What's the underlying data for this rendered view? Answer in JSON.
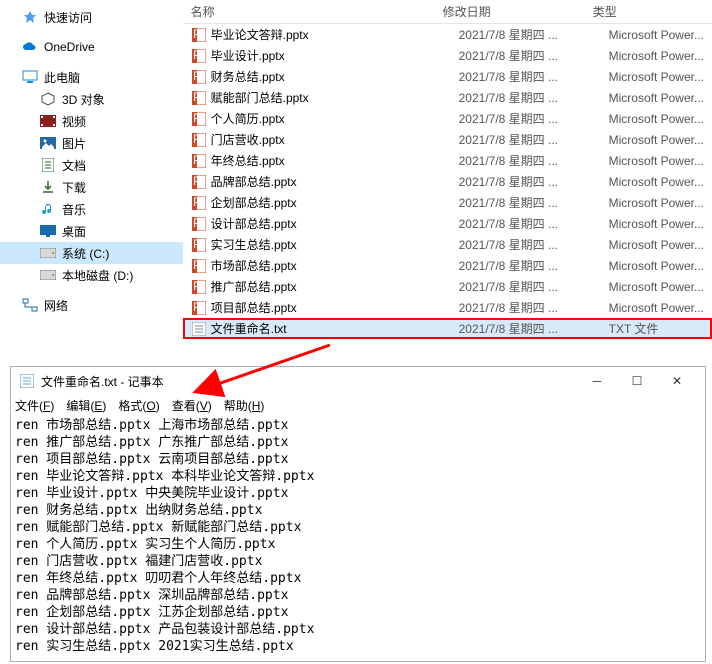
{
  "sidebar": [
    {
      "label": "快速访问",
      "icon": "star",
      "color": "#4aa0e6"
    },
    {
      "label": "OneDrive",
      "icon": "cloud",
      "color": "#0078d4"
    },
    {
      "label": "此电脑",
      "icon": "pc",
      "color": "#1e88e5"
    },
    {
      "label": "3D 对象",
      "icon": "cube",
      "color": "#4a4a4a",
      "indent": true
    },
    {
      "label": "视频",
      "icon": "video",
      "color": "#8a2020",
      "indent": true
    },
    {
      "label": "图片",
      "icon": "image",
      "color": "#206aa8",
      "indent": true
    },
    {
      "label": "文档",
      "icon": "doc",
      "color": "#2a6e2a",
      "indent": true
    },
    {
      "label": "下载",
      "icon": "download",
      "color": "#2a6e2a",
      "indent": true
    },
    {
      "label": "音乐",
      "icon": "music",
      "color": "#1c9cd0",
      "indent": true
    },
    {
      "label": "桌面",
      "icon": "desktop",
      "color": "#1c6aa8",
      "indent": true
    },
    {
      "label": "系统 (C:)",
      "icon": "drive",
      "color": "#808080",
      "indent": true,
      "selected": true
    },
    {
      "label": "本地磁盘 (D:)",
      "icon": "drive",
      "color": "#808080",
      "indent": true
    },
    {
      "label": "网络",
      "icon": "network",
      "color": "#1c6aa8"
    }
  ],
  "columns": {
    "name": "名称",
    "date": "修改日期",
    "type": "类型"
  },
  "files": [
    {
      "name": "毕业论文答辩.pptx",
      "date": "2021/7/8 星期四 ...",
      "type": "Microsoft Power...",
      "icon": "ppt"
    },
    {
      "name": "毕业设计.pptx",
      "date": "2021/7/8 星期四 ...",
      "type": "Microsoft Power...",
      "icon": "ppt"
    },
    {
      "name": "财务总结.pptx",
      "date": "2021/7/8 星期四 ...",
      "type": "Microsoft Power...",
      "icon": "ppt"
    },
    {
      "name": "赋能部门总结.pptx",
      "date": "2021/7/8 星期四 ...",
      "type": "Microsoft Power...",
      "icon": "ppt"
    },
    {
      "name": "个人简历.pptx",
      "date": "2021/7/8 星期四 ...",
      "type": "Microsoft Power...",
      "icon": "ppt"
    },
    {
      "name": "门店营收.pptx",
      "date": "2021/7/8 星期四 ...",
      "type": "Microsoft Power...",
      "icon": "ppt"
    },
    {
      "name": "年终总结.pptx",
      "date": "2021/7/8 星期四 ...",
      "type": "Microsoft Power...",
      "icon": "ppt"
    },
    {
      "name": "品牌部总结.pptx",
      "date": "2021/7/8 星期四 ...",
      "type": "Microsoft Power...",
      "icon": "ppt"
    },
    {
      "name": "企划部总结.pptx",
      "date": "2021/7/8 星期四 ...",
      "type": "Microsoft Power...",
      "icon": "ppt"
    },
    {
      "name": "设计部总结.pptx",
      "date": "2021/7/8 星期四 ...",
      "type": "Microsoft Power...",
      "icon": "ppt"
    },
    {
      "name": "实习生总结.pptx",
      "date": "2021/7/8 星期四 ...",
      "type": "Microsoft Power...",
      "icon": "ppt"
    },
    {
      "name": "市场部总结.pptx",
      "date": "2021/7/8 星期四 ...",
      "type": "Microsoft Power...",
      "icon": "ppt"
    },
    {
      "name": "推广部总结.pptx",
      "date": "2021/7/8 星期四 ...",
      "type": "Microsoft Power...",
      "icon": "ppt"
    },
    {
      "name": "项目部总结.pptx",
      "date": "2021/7/8 星期四 ...",
      "type": "Microsoft Power...",
      "icon": "ppt"
    },
    {
      "name": "文件重命名.txt",
      "date": "2021/7/8 星期四 ...",
      "type": "TXT 文件",
      "icon": "txt",
      "highlighted": true
    }
  ],
  "notepad": {
    "title": "文件重命名.txt - 记事本",
    "menu": [
      "文件(F)",
      "编辑(E)",
      "格式(O)",
      "查看(V)",
      "帮助(H)"
    ],
    "lines": [
      "ren 市场部总结.pptx 上海市场部总结.pptx",
      "ren 推广部总结.pptx 广东推广部总结.pptx",
      "ren 项目部总结.pptx 云南项目部总结.pptx",
      "ren 毕业论文答辩.pptx 本科毕业论文答辩.pptx",
      "ren 毕业设计.pptx 中央美院毕业设计.pptx",
      "ren 财务总结.pptx 出纳财务总结.pptx",
      "ren 赋能部门总结.pptx 新赋能部门总结.pptx",
      "ren 个人简历.pptx 实习生个人简历.pptx",
      "ren 门店营收.pptx 福建门店营收.pptx",
      "ren 年终总结.pptx 叨叨君个人年终总结.pptx",
      "ren 品牌部总结.pptx 深圳品牌部总结.pptx",
      "ren 企划部总结.pptx 江苏企划部总结.pptx",
      "ren 设计部总结.pptx 产品包装设计部总结.pptx",
      "ren 实习生总结.pptx 2021实习生总结.pptx"
    ]
  }
}
